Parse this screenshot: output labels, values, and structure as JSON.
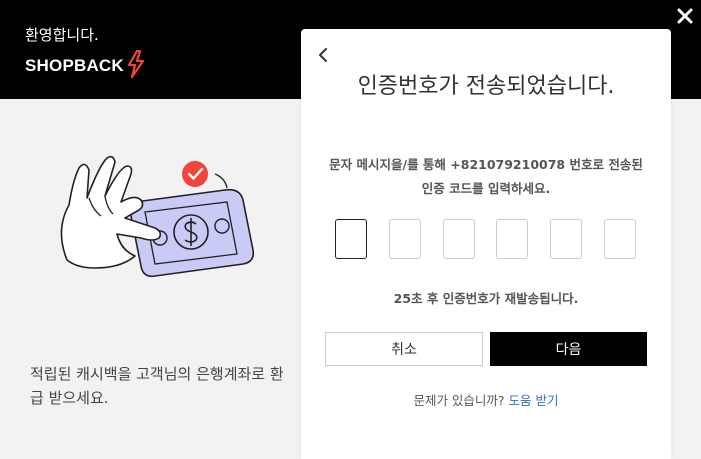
{
  "header": {
    "welcome": "환영합니다.",
    "logo_text": "SHOPBACK",
    "colors": {
      "background": "#000000",
      "logo_bolt": "#f0453b"
    }
  },
  "left_panel": {
    "description": "적립된 캐시백을 고객님의 은행계좌로 환급 받으세요.",
    "illustration_icons": [
      "hand-icon",
      "banknote-icon",
      "dollar-icon",
      "checkmark-badge-icon"
    ],
    "colors": {
      "banknote": "#c9caf5",
      "check_badge": "#f0453b"
    }
  },
  "modal": {
    "title": "인증번호가 전송되었습니다.",
    "instruction": "문자 메시지을/를 통해 +821079210078 번호로 전송된 인증 코드를 입력하세요.",
    "code_inputs": [
      "",
      "",
      "",
      "",
      "",
      ""
    ],
    "resend_text": "25초 후 인증번호가 재발송됩니다.",
    "cancel_label": "취소",
    "next_label": "다음",
    "help_text": "문제가 있습니까?",
    "help_link": "도움 받기",
    "colors": {
      "link": "#2f6fc9",
      "primary_button": "#000000"
    }
  }
}
